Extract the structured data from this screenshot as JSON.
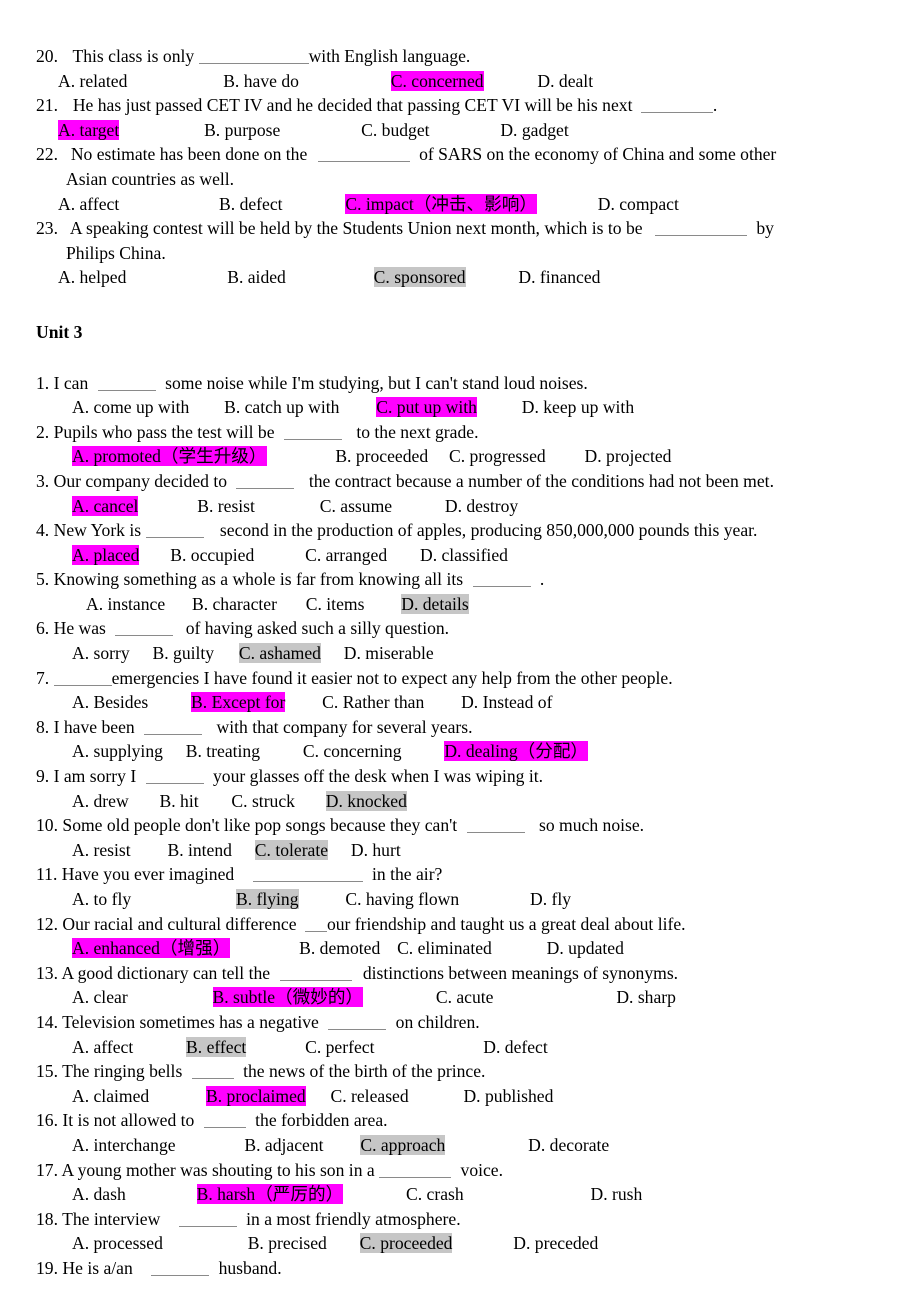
{
  "document": {
    "unit_heading": "Unit 3",
    "colors": {
      "highlight_answer_magenta": "#ff00ff",
      "highlight_answer_gray": "#c6c6c6",
      "text": "#000000",
      "blank_line": "#8a8a8a",
      "page_background": "#ffffff"
    }
  },
  "section_one": {
    "questions": [
      {
        "number": "20.",
        "stem_before": "This class is only",
        "stem_after": "with English language.",
        "options": [
          {
            "label": "A. related",
            "highlight": "none"
          },
          {
            "label": "B. have do",
            "highlight": "none"
          },
          {
            "label": "C. concerned",
            "highlight": "magenta"
          },
          {
            "label": "D. dealt",
            "highlight": "none"
          }
        ]
      },
      {
        "number": "21.",
        "stem_before": "He has just passed CET IV and he decided that passing CET VI will be his next",
        "stem_after": ".",
        "options": [
          {
            "label": "A. target",
            "highlight": "magenta"
          },
          {
            "label": "B. purpose",
            "highlight": "none"
          },
          {
            "label": "C. budget",
            "highlight": "none"
          },
          {
            "label": "D. gadget",
            "highlight": "none"
          }
        ]
      },
      {
        "number": "22.",
        "stem_before": "No estimate has been done on the",
        "stem_after": "of SARS on the economy of China and some other",
        "stem_line2": "Asian countries as well.",
        "options": [
          {
            "label": "A. affect",
            "highlight": "none"
          },
          {
            "label": "B. defect",
            "highlight": "none"
          },
          {
            "label": "C. impact（冲击、影响）",
            "highlight": "magenta"
          },
          {
            "label": "D. compact",
            "highlight": "none"
          }
        ]
      },
      {
        "number": "23.",
        "stem_before": "A speaking contest will be held by the Students Union next month, which is to be",
        "stem_after": "by",
        "stem_line2": "Philips China.",
        "options": [
          {
            "label": "A. helped",
            "highlight": "none"
          },
          {
            "label": "B. aided",
            "highlight": "none"
          },
          {
            "label": "C. sponsored",
            "highlight": "gray"
          },
          {
            "label": "D. financed",
            "highlight": "none"
          }
        ]
      }
    ]
  },
  "unit_three": {
    "questions": [
      {
        "number": "1.",
        "stem_before": "I can",
        "stem_after": "some noise while I'm studying, but I can't stand loud noises.",
        "options": [
          {
            "label": "A. come up with",
            "highlight": "none"
          },
          {
            "label": "B. catch up with",
            "highlight": "none"
          },
          {
            "label": "C. put up with",
            "highlight": "magenta"
          },
          {
            "label": "D. keep up with",
            "highlight": "none"
          }
        ]
      },
      {
        "number": "2.",
        "stem_before": "Pupils who pass the test will be",
        "stem_after": "to the next grade.",
        "options": [
          {
            "label": "A. promoted（学生升级）",
            "highlight": "magenta"
          },
          {
            "label": "B. proceeded",
            "highlight": "none"
          },
          {
            "label": "C. progressed",
            "highlight": "none"
          },
          {
            "label": "D. projected",
            "highlight": "none"
          }
        ]
      },
      {
        "number": "3.",
        "stem_before": "Our company decided to",
        "stem_after": "the contract because a number of the conditions had not been met.",
        "options": [
          {
            "label": "A. cancel",
            "highlight": "magenta"
          },
          {
            "label": "B. resist",
            "highlight": "none"
          },
          {
            "label": "C. assume",
            "highlight": "none"
          },
          {
            "label": "D. destroy",
            "highlight": "none"
          }
        ]
      },
      {
        "number": "4.",
        "stem_before": "New York is",
        "stem_after": "second in the production of apples, producing 850,000,000 pounds this year.",
        "options": [
          {
            "label": "A. placed",
            "highlight": "magenta"
          },
          {
            "label": "B. occupied",
            "highlight": "none"
          },
          {
            "label": "C. arranged",
            "highlight": "none"
          },
          {
            "label": "D. classified",
            "highlight": "none"
          }
        ]
      },
      {
        "number": "5.",
        "stem_before": "Knowing something as a whole is far from knowing all its",
        "stem_after": ".",
        "options": [
          {
            "label": "A. instance",
            "highlight": "none"
          },
          {
            "label": "B. character",
            "highlight": "none"
          },
          {
            "label": "C. items",
            "highlight": "none"
          },
          {
            "label": "D. details",
            "highlight": "gray"
          }
        ]
      },
      {
        "number": "6.",
        "stem_before": "He was",
        "stem_after": "of having asked such a silly question.",
        "options": [
          {
            "label": "A. sorry",
            "highlight": "none"
          },
          {
            "label": "B. guilty",
            "highlight": "none"
          },
          {
            "label": "C. ashamed",
            "highlight": "gray"
          },
          {
            "label": "D. miserable",
            "highlight": "none"
          }
        ]
      },
      {
        "number": "7.",
        "stem_before": "",
        "stem_after": "emergencies I have found it easier not to expect any help from the other people.",
        "options": [
          {
            "label": "A. Besides",
            "highlight": "none"
          },
          {
            "label": "B. Except for",
            "highlight": "magenta"
          },
          {
            "label": "C. Rather than",
            "highlight": "none"
          },
          {
            "label": "D. Instead of",
            "highlight": "none"
          }
        ]
      },
      {
        "number": "8.",
        "stem_before": "I have been",
        "stem_after": "with that company for several years.",
        "options": [
          {
            "label": "A. supplying",
            "highlight": "none"
          },
          {
            "label": "B. treating",
            "highlight": "none"
          },
          {
            "label": "C. concerning",
            "highlight": "none"
          },
          {
            "label": "D. dealing（分配）",
            "highlight": "magenta"
          }
        ]
      },
      {
        "number": "9.",
        "stem_before": "I am sorry I",
        "stem_after": "your glasses off the desk when I was wiping it.",
        "options": [
          {
            "label": "A. drew",
            "highlight": "none"
          },
          {
            "label": "B. hit",
            "highlight": "none"
          },
          {
            "label": "C. struck",
            "highlight": "none"
          },
          {
            "label": "D. knocked",
            "highlight": "gray"
          }
        ]
      },
      {
        "number": "10.",
        "stem_before": "Some old people don't like pop songs because   they can't",
        "stem_after": "so much noise.",
        "options": [
          {
            "label": "A. resist",
            "highlight": "none"
          },
          {
            "label": "B. intend",
            "highlight": "none"
          },
          {
            "label": "C. tolerate",
            "highlight": "gray"
          },
          {
            "label": "D. hurt",
            "highlight": "none"
          }
        ]
      },
      {
        "number": "11.",
        "stem_before": "Have you ever imagined",
        "stem_after": "in the air?",
        "options": [
          {
            "label": "A. to fly",
            "highlight": "none"
          },
          {
            "label": "B. flying",
            "highlight": "gray"
          },
          {
            "label": "C. having flown",
            "highlight": "none"
          },
          {
            "label": "D. fly",
            "highlight": "none"
          }
        ]
      },
      {
        "number": "12.",
        "stem_before": "Our racial and cultural difference",
        "stem_after": "our friendship and taught us a great deal about life.",
        "options": [
          {
            "label": "A. enhanced（增强）",
            "highlight": "magenta"
          },
          {
            "label": "B. demoted",
            "highlight": "none"
          },
          {
            "label": "C. eliminated",
            "highlight": "none"
          },
          {
            "label": "D. updated",
            "highlight": "none"
          }
        ]
      },
      {
        "number": "13.",
        "stem_before": "A good dictionary can tell the",
        "stem_after": "distinctions between meanings of synonyms.",
        "options": [
          {
            "label": "A. clear",
            "highlight": "none"
          },
          {
            "label": "B. subtle（微妙的）",
            "highlight": "magenta"
          },
          {
            "label": "C. acute",
            "highlight": "none"
          },
          {
            "label": "D. sharp",
            "highlight": "none"
          }
        ]
      },
      {
        "number": "14.",
        "stem_before": "Television sometimes has a negative",
        "stem_after": "on children.",
        "options": [
          {
            "label": "A. affect",
            "highlight": "none"
          },
          {
            "label": "B. effect",
            "highlight": "gray"
          },
          {
            "label": "C. perfect",
            "highlight": "none"
          },
          {
            "label": "D. defect",
            "highlight": "none"
          }
        ]
      },
      {
        "number": "15.",
        "stem_before": "The ringing bells",
        "stem_after": "the news of the birth of the prince.",
        "options": [
          {
            "label": "A. claimed",
            "highlight": "none"
          },
          {
            "label": "B. proclaimed",
            "highlight": "magenta"
          },
          {
            "label": "C. released",
            "highlight": "none"
          },
          {
            "label": "D. published",
            "highlight": "none"
          }
        ]
      },
      {
        "number": "16.",
        "stem_before": "It is not allowed to",
        "stem_after": "the forbidden area.",
        "options": [
          {
            "label": "A. interchange",
            "highlight": "none"
          },
          {
            "label": "B. adjacent",
            "highlight": "none"
          },
          {
            "label": "C. approach",
            "highlight": "gray"
          },
          {
            "label": "D. decorate",
            "highlight": "none"
          }
        ]
      },
      {
        "number": "17.",
        "stem_before": "A young mother was shouting to his son in a",
        "stem_after": "voice.",
        "options": [
          {
            "label": "A. dash",
            "highlight": "none"
          },
          {
            "label": "B. harsh（严厉的）",
            "highlight": "magenta"
          },
          {
            "label": "C. crash",
            "highlight": "none"
          },
          {
            "label": "D. rush",
            "highlight": "none"
          }
        ]
      },
      {
        "number": "18.",
        "stem_before": "The interview",
        "stem_after": "in a most friendly atmosphere.",
        "options": [
          {
            "label": "A. processed",
            "highlight": "none"
          },
          {
            "label": "B. precised",
            "highlight": "none"
          },
          {
            "label": "C. proceeded",
            "highlight": "gray"
          },
          {
            "label": "D. preceded",
            "highlight": "none"
          }
        ]
      },
      {
        "number": "19.",
        "stem_before": "He is a/an",
        "stem_after": "husband.",
        "options": []
      }
    ]
  }
}
